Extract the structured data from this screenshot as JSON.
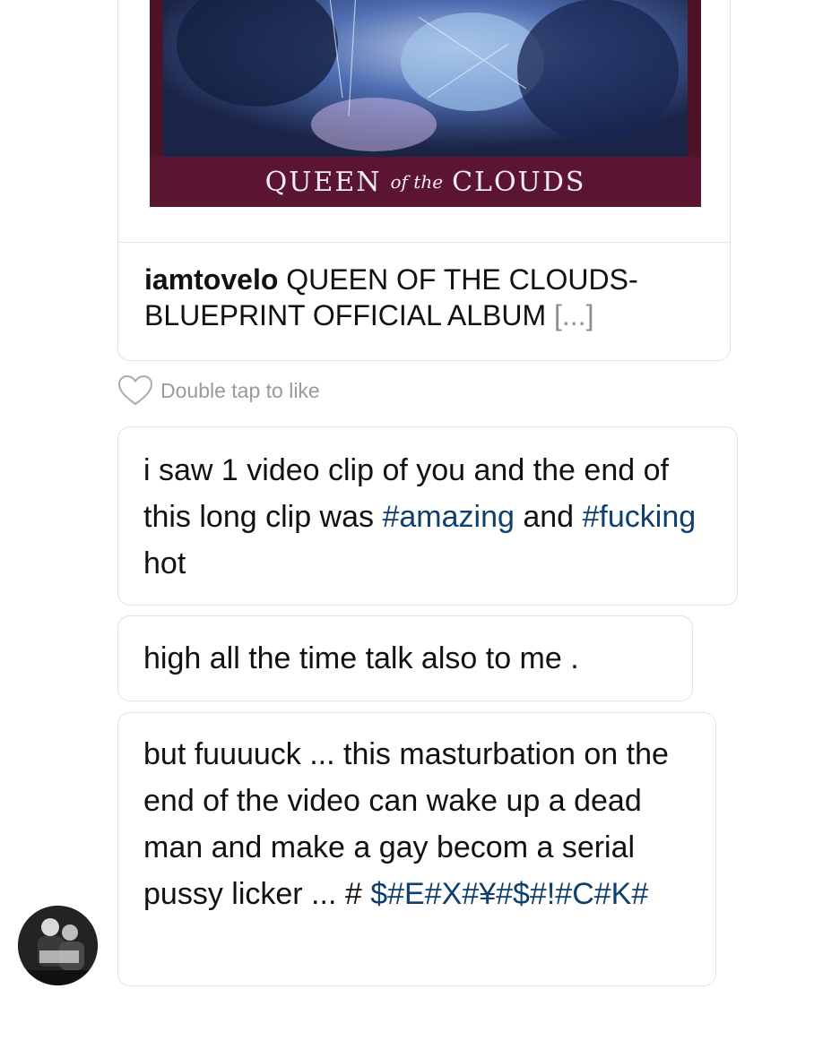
{
  "shared_post": {
    "album_cover": {
      "title_word1": "QUEEN",
      "title_word2": "of the",
      "title_word3": "CLOUDS"
    },
    "caption_user": "iamtovelo",
    "caption_text": " QUEEN OF THE CLOUDS- BLUEPRINT OFFICIAL ALBUM ",
    "caption_more": "[...]"
  },
  "like_hint": "Double tap to like",
  "messages": [
    {
      "parts": [
        {
          "text": "i saw 1 video clip of you and the end of this long clip was ",
          "hashtag": false
        },
        {
          "text": "#amazing",
          "hashtag": true
        },
        {
          "text": " and ",
          "hashtag": false
        },
        {
          "text": "#fucking",
          "hashtag": true
        },
        {
          "text": " hot",
          "hashtag": false
        }
      ]
    },
    {
      "parts": [
        {
          "text": "high all the time talk also to me .",
          "hashtag": false
        }
      ]
    },
    {
      "parts": [
        {
          "text": "but fuuuuck ... this masturbation on the end of the video can wake up a dead man and make a gay becom a serial pussy licker ... # ",
          "hashtag": false
        },
        {
          "text": "$#E#X#¥#$#!#C#K#",
          "hashtag": true
        }
      ]
    }
  ],
  "colors": {
    "hashtag": "#0f3f6d",
    "album_background": "#5c1531",
    "muted_text": "#999999"
  },
  "icons": {
    "like": "heart-outline-icon",
    "sender": "avatar"
  }
}
